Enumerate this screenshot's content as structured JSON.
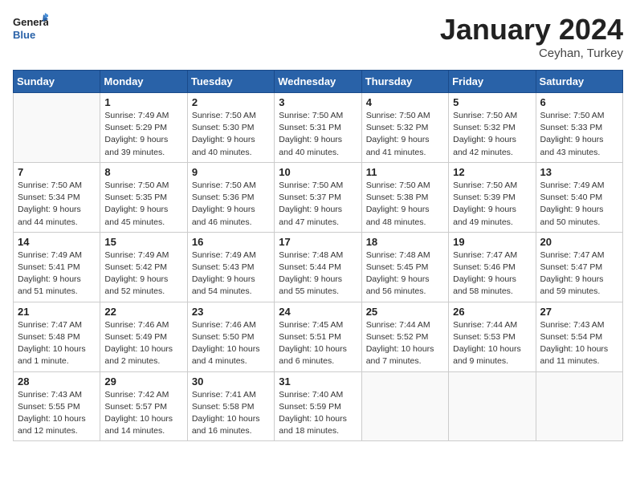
{
  "header": {
    "logo_general": "General",
    "logo_blue": "Blue",
    "month": "January 2024",
    "location": "Ceyhan, Turkey"
  },
  "weekdays": [
    "Sunday",
    "Monday",
    "Tuesday",
    "Wednesday",
    "Thursday",
    "Friday",
    "Saturday"
  ],
  "weeks": [
    [
      {
        "day": "",
        "info": ""
      },
      {
        "day": "1",
        "info": "Sunrise: 7:49 AM\nSunset: 5:29 PM\nDaylight: 9 hours\nand 39 minutes."
      },
      {
        "day": "2",
        "info": "Sunrise: 7:50 AM\nSunset: 5:30 PM\nDaylight: 9 hours\nand 40 minutes."
      },
      {
        "day": "3",
        "info": "Sunrise: 7:50 AM\nSunset: 5:31 PM\nDaylight: 9 hours\nand 40 minutes."
      },
      {
        "day": "4",
        "info": "Sunrise: 7:50 AM\nSunset: 5:32 PM\nDaylight: 9 hours\nand 41 minutes."
      },
      {
        "day": "5",
        "info": "Sunrise: 7:50 AM\nSunset: 5:32 PM\nDaylight: 9 hours\nand 42 minutes."
      },
      {
        "day": "6",
        "info": "Sunrise: 7:50 AM\nSunset: 5:33 PM\nDaylight: 9 hours\nand 43 minutes."
      }
    ],
    [
      {
        "day": "7",
        "info": "Sunrise: 7:50 AM\nSunset: 5:34 PM\nDaylight: 9 hours\nand 44 minutes."
      },
      {
        "day": "8",
        "info": "Sunrise: 7:50 AM\nSunset: 5:35 PM\nDaylight: 9 hours\nand 45 minutes."
      },
      {
        "day": "9",
        "info": "Sunrise: 7:50 AM\nSunset: 5:36 PM\nDaylight: 9 hours\nand 46 minutes."
      },
      {
        "day": "10",
        "info": "Sunrise: 7:50 AM\nSunset: 5:37 PM\nDaylight: 9 hours\nand 47 minutes."
      },
      {
        "day": "11",
        "info": "Sunrise: 7:50 AM\nSunset: 5:38 PM\nDaylight: 9 hours\nand 48 minutes."
      },
      {
        "day": "12",
        "info": "Sunrise: 7:50 AM\nSunset: 5:39 PM\nDaylight: 9 hours\nand 49 minutes."
      },
      {
        "day": "13",
        "info": "Sunrise: 7:49 AM\nSunset: 5:40 PM\nDaylight: 9 hours\nand 50 minutes."
      }
    ],
    [
      {
        "day": "14",
        "info": "Sunrise: 7:49 AM\nSunset: 5:41 PM\nDaylight: 9 hours\nand 51 minutes."
      },
      {
        "day": "15",
        "info": "Sunrise: 7:49 AM\nSunset: 5:42 PM\nDaylight: 9 hours\nand 52 minutes."
      },
      {
        "day": "16",
        "info": "Sunrise: 7:49 AM\nSunset: 5:43 PM\nDaylight: 9 hours\nand 54 minutes."
      },
      {
        "day": "17",
        "info": "Sunrise: 7:48 AM\nSunset: 5:44 PM\nDaylight: 9 hours\nand 55 minutes."
      },
      {
        "day": "18",
        "info": "Sunrise: 7:48 AM\nSunset: 5:45 PM\nDaylight: 9 hours\nand 56 minutes."
      },
      {
        "day": "19",
        "info": "Sunrise: 7:47 AM\nSunset: 5:46 PM\nDaylight: 9 hours\nand 58 minutes."
      },
      {
        "day": "20",
        "info": "Sunrise: 7:47 AM\nSunset: 5:47 PM\nDaylight: 9 hours\nand 59 minutes."
      }
    ],
    [
      {
        "day": "21",
        "info": "Sunrise: 7:47 AM\nSunset: 5:48 PM\nDaylight: 10 hours\nand 1 minute."
      },
      {
        "day": "22",
        "info": "Sunrise: 7:46 AM\nSunset: 5:49 PM\nDaylight: 10 hours\nand 2 minutes."
      },
      {
        "day": "23",
        "info": "Sunrise: 7:46 AM\nSunset: 5:50 PM\nDaylight: 10 hours\nand 4 minutes."
      },
      {
        "day": "24",
        "info": "Sunrise: 7:45 AM\nSunset: 5:51 PM\nDaylight: 10 hours\nand 6 minutes."
      },
      {
        "day": "25",
        "info": "Sunrise: 7:44 AM\nSunset: 5:52 PM\nDaylight: 10 hours\nand 7 minutes."
      },
      {
        "day": "26",
        "info": "Sunrise: 7:44 AM\nSunset: 5:53 PM\nDaylight: 10 hours\nand 9 minutes."
      },
      {
        "day": "27",
        "info": "Sunrise: 7:43 AM\nSunset: 5:54 PM\nDaylight: 10 hours\nand 11 minutes."
      }
    ],
    [
      {
        "day": "28",
        "info": "Sunrise: 7:43 AM\nSunset: 5:55 PM\nDaylight: 10 hours\nand 12 minutes."
      },
      {
        "day": "29",
        "info": "Sunrise: 7:42 AM\nSunset: 5:57 PM\nDaylight: 10 hours\nand 14 minutes."
      },
      {
        "day": "30",
        "info": "Sunrise: 7:41 AM\nSunset: 5:58 PM\nDaylight: 10 hours\nand 16 minutes."
      },
      {
        "day": "31",
        "info": "Sunrise: 7:40 AM\nSunset: 5:59 PM\nDaylight: 10 hours\nand 18 minutes."
      },
      {
        "day": "",
        "info": ""
      },
      {
        "day": "",
        "info": ""
      },
      {
        "day": "",
        "info": ""
      }
    ]
  ]
}
